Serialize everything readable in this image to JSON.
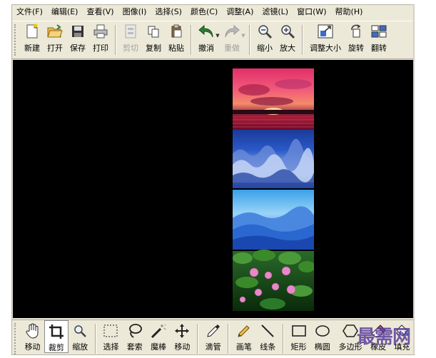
{
  "menu": [
    "文件(F)",
    "编辑(E)",
    "查看(V)",
    "图像(I)",
    "选择(S)",
    "颜色(C)",
    "调整(A)",
    "滤镜(L)",
    "窗口(W)",
    "帮助(H)"
  ],
  "toolbar": {
    "new": "新建",
    "open": "打开",
    "save": "保存",
    "print": "打印",
    "cut": "剪切",
    "copy": "复制",
    "paste": "粘贴",
    "undo": "撤消",
    "redo": "重做",
    "zoom_out": "缩小",
    "zoom_in": "放大",
    "resize": "调整大小",
    "rotate": "旋转",
    "flip": "翻转"
  },
  "tools": {
    "move": "移动",
    "crop": "裁剪",
    "zoom": "缩放",
    "select": "选择",
    "lasso": "套索",
    "magic_wand": "魔棒",
    "move_selection": "移动",
    "eyedropper": "滴管",
    "pencil": "画笔",
    "line": "线条",
    "rectangle": "矩形",
    "ellipse": "椭圆",
    "polygon": "多边形",
    "eraser": "橡皮",
    "fill": "填充"
  },
  "watermark": "最需网",
  "colors": {
    "chrome": "#ece9d8",
    "canvas": "#000000",
    "accent_green": "#2e7d32"
  }
}
